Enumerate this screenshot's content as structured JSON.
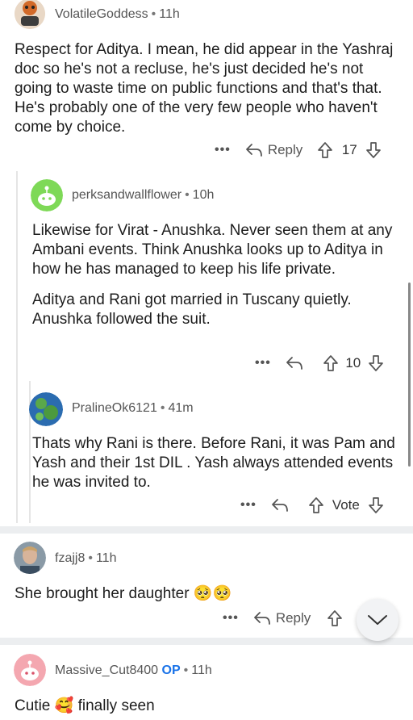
{
  "comments": [
    {
      "user": "VolatileGoddess",
      "time": "11h",
      "body": "Respect for Aditya. I mean, he did appear in the Yashraj doc so he's not a recluse, he's just decided he's not going to waste time on public functions and that's that. He's probably one of the very few people who haven't come by choice.",
      "reply_label": "Reply",
      "votes": "17"
    },
    {
      "user": "perksandwallflower",
      "time": "10h",
      "body_p1": "Likewise for Virat - Anushka. Never seen them at any Ambani events. Think Anushka looks up to Aditya in how he has managed to keep his life private.",
      "body_p2": "Aditya and Rani got married in Tuscany quietly. Anushka followed the suit.",
      "votes": "10"
    },
    {
      "user": "PralineOk6121",
      "time": "41m",
      "body": "Thats why Rani is there. Before Rani, it was Pam and Yash and their 1st DIL . Yash always attended events he was invited to.",
      "votes": "Vote"
    },
    {
      "user": "fzajj8",
      "time": "11h",
      "body": "She brought her daughter",
      "emoji": "🥺🥺",
      "reply_label": "Reply"
    },
    {
      "user": "Massive_Cut8400",
      "op_badge": "OP",
      "time": "11h",
      "body_a": "Cutie",
      "emoji": "🥰",
      "body_b": "finally seen"
    }
  ],
  "ui": {
    "dot": "•",
    "more": "•••"
  },
  "colors": {
    "op_blue": "#1a73e8",
    "divider": "#eceef0",
    "meta_gray": "#555555"
  }
}
